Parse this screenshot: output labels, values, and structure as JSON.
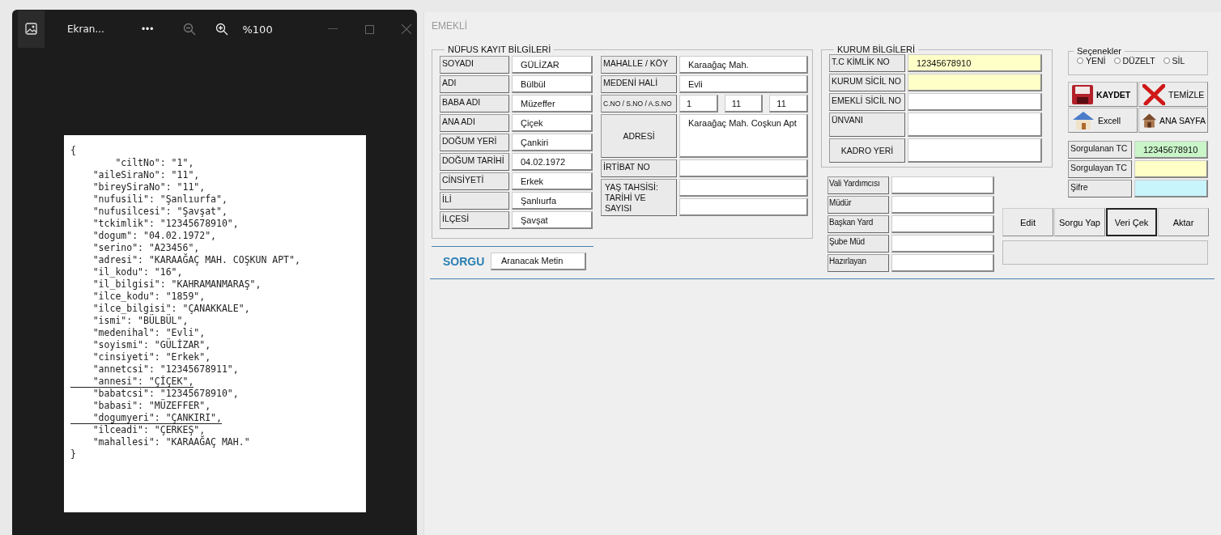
{
  "viewer": {
    "title": "Ekran...",
    "more": "•••",
    "zoom": "%100",
    "document_lines": [
      {
        "text": "{",
        "underlined": false
      },
      {
        "text": "        \"ciltNo\": \"1\",",
        "underlined": false
      },
      {
        "text": "    \"aileSiraNo\": \"11\",",
        "underlined": false
      },
      {
        "text": "    \"bireySiraNo\": \"11\",",
        "underlined": false
      },
      {
        "text": "    \"nufusili\": \"Şanlıurfa\",",
        "underlined": false
      },
      {
        "text": "    \"nufusilcesi\": \"Şavşat\",",
        "underlined": false
      },
      {
        "text": "    \"tckimlik\": \"12345678910\",",
        "underlined": false
      },
      {
        "text": "    \"dogum\": \"04.02.1972\",",
        "underlined": false
      },
      {
        "text": "    \"serino\": \"A23456\",",
        "underlined": false
      },
      {
        "text": "    \"adresi\": \"KARAAĞAÇ MAH. COŞKUN APT\",",
        "underlined": false
      },
      {
        "text": "    \"il_kodu\": \"16\",",
        "underlined": false
      },
      {
        "text": "    \"il_bilgisi\": \"KAHRAMANMARAŞ\",",
        "underlined": false
      },
      {
        "text": "    \"ilce_kodu\": \"1859\",",
        "underlined": false
      },
      {
        "text": "    \"ilce_bilgisi\": \"ÇANAKKALE\",",
        "underlined": false
      },
      {
        "text": "    \"ismi\": \"BÜLBÜL\",",
        "underlined": false
      },
      {
        "text": "    \"medenihal\": \"Evli\",",
        "underlined": false
      },
      {
        "text": "    \"soyismi\": \"GÜLİZAR\",",
        "underlined": false
      },
      {
        "text": "    \"cinsiyeti\": \"Erkek\",",
        "underlined": false
      },
      {
        "text": "    \"annetcsi\": \"12345678911\",",
        "underlined": false
      },
      {
        "text": "    \"annesi\": \"ÇİÇEK\",",
        "underlined": true
      },
      {
        "text": "    \"babatcsi\": \"12345678910\",",
        "underlined": false
      },
      {
        "text": "    \"babasi\": \"MÜZEFFER\",",
        "underlined": false
      },
      {
        "text": "    \"dogumyeri\": \"ÇANKIRI\",",
        "underlined": true
      },
      {
        "text": "    \"ilceadi\": \"ÇERKEŞ\",",
        "underlined": false
      },
      {
        "text": "    \"mahallesi\": \"KARAAĞAÇ MAH.\"",
        "underlined": false
      },
      {
        "text": "}",
        "underlined": false
      }
    ]
  },
  "form": {
    "title": "EMEKLİ",
    "nufus": {
      "legend": "NÜFUS KAYIT BİLGİLERİ",
      "rows": [
        {
          "label": "SOYADI",
          "value": "GÜLİZAR"
        },
        {
          "label": "ADI",
          "value": "Bülbül"
        },
        {
          "label": "BABA ADI",
          "value": "Müzeffer"
        },
        {
          "label": "ANA ADI",
          "value": "Çiçek"
        },
        {
          "label": "DOĞUM YERİ",
          "value": "Çankiri"
        },
        {
          "label": "DOĞUM TARİHİ",
          "value": "04.02.1972"
        },
        {
          "label": "CİNSİYETİ",
          "value": "Erkek"
        },
        {
          "label": "İLİ",
          "value": "Şanlıurfa"
        },
        {
          "label": "İLÇESİ",
          "value": "Şavşat"
        }
      ],
      "right_rows": [
        {
          "kind": "single",
          "label": "MAHALLE / KÖY",
          "value": "Karaağaç Mah."
        },
        {
          "kind": "single",
          "label": "MEDENİ HALİ",
          "value": "Evli"
        },
        {
          "kind": "triple",
          "label": "C.NO / S.NO / A.S.NO",
          "values": [
            "1",
            "11",
            "11"
          ]
        },
        {
          "kind": "tall",
          "label": "ADRESİ",
          "value": "Karaağaç Mah. Coşkun Apt"
        },
        {
          "kind": "single",
          "label": "İRTİBAT NO"
        },
        {
          "kind": "double",
          "label": "YAŞ TAHSİSİ: TARİHİ VE SAYISI"
        }
      ]
    },
    "sorgu": {
      "label": "SORGU",
      "value": "Aranacak Metin"
    },
    "kurum": {
      "legend": "KURUM BİLGİLERİ",
      "rows": [
        {
          "kind": "single",
          "label": "T.C KİMLİK  NO",
          "value": "12345678910",
          "color": "#ffffc8"
        },
        {
          "kind": "single",
          "label": "KURUM SİCİL NO",
          "color": "#ffffc8"
        },
        {
          "kind": "single",
          "label": "EMEKLİ SİCİL NO",
          "color": "#ffffff"
        },
        {
          "kind": "tall",
          "label": "ÜNVANI",
          "color": "#ffffff"
        },
        {
          "kind": "tall",
          "label": "KADRO YERİ",
          "color": "#ffffff"
        }
      ]
    },
    "signatures": [
      {
        "label": "Vali Yardımcısı"
      },
      {
        "label": "Müdür"
      },
      {
        "label": "Başkan Yard"
      },
      {
        "label": "Şube Müd"
      },
      {
        "label": "Hazırlayan"
      }
    ],
    "options": {
      "legend": "Seçenekler",
      "items": [
        {
          "label": "YENİ",
          "selected": false
        },
        {
          "label": "DÜZELT",
          "selected": false
        },
        {
          "label": "SİL",
          "selected": false
        }
      ]
    },
    "buttons": [
      {
        "kind": "save",
        "label": "KAYDET"
      },
      {
        "kind": "clear",
        "label": "TEMİZLE"
      },
      {
        "kind": "excel",
        "label": "Excell"
      },
      {
        "kind": "home",
        "label": "ANA SAYFA"
      }
    ],
    "query": [
      {
        "label": "Sorgulanan TC",
        "value": "12345678910",
        "color": "#c9f5c9"
      },
      {
        "label": "Sorgulayan TC",
        "color": "#ffffc8"
      },
      {
        "label": "Şifre",
        "color": "#c8f4fb"
      }
    ],
    "actions": [
      {
        "label": "Edit",
        "focused": false
      },
      {
        "label": "Sorgu Yap",
        "focused": false
      },
      {
        "label": "Veri Çek",
        "focused": true
      },
      {
        "label": "Aktar",
        "focused": false
      }
    ]
  }
}
